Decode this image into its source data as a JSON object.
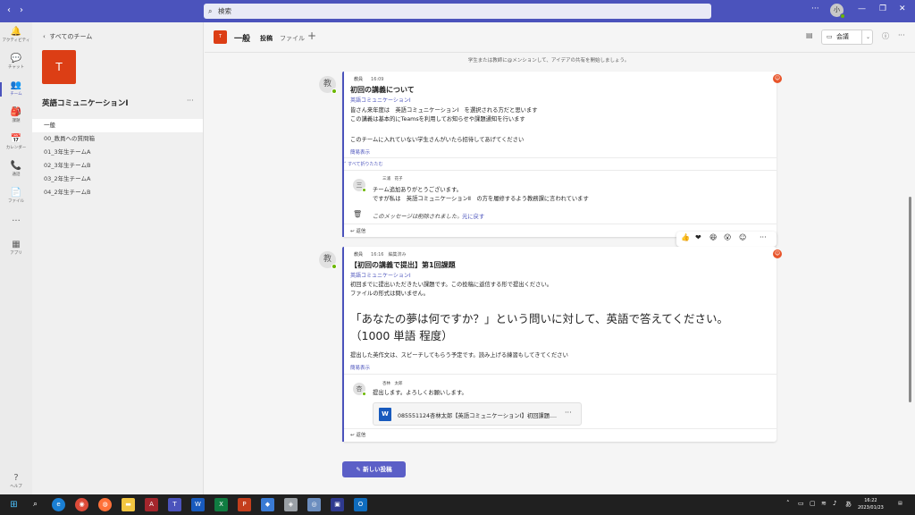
{
  "titlebar": {
    "search_placeholder": "検索",
    "avatar_initial": "小"
  },
  "rail": [
    {
      "label": "アクティビティ",
      "icon": "bell-icon",
      "glyph": "🔔"
    },
    {
      "label": "チャット",
      "icon": "chat-icon",
      "glyph": "💬"
    },
    {
      "label": "チーム",
      "icon": "teams-icon",
      "glyph": "👥"
    },
    {
      "label": "課題",
      "icon": "assignments-icon",
      "glyph": "🎒"
    },
    {
      "label": "カレンダー",
      "icon": "calendar-icon",
      "glyph": "📅"
    },
    {
      "label": "通話",
      "icon": "phone-icon",
      "glyph": "📞"
    },
    {
      "label": "ファイル",
      "icon": "file-icon",
      "glyph": "📄"
    },
    {
      "label": "アプリ",
      "icon": "apps-icon",
      "glyph": "▦"
    },
    {
      "label": "ヘルプ",
      "icon": "help-icon",
      "glyph": "?"
    }
  ],
  "sidebar": {
    "back_label": "すべてのチーム",
    "team_initial": "T",
    "team_name": "英語コミュニケーションⅠ",
    "channels": [
      "一般",
      "00_教員への質問箱",
      "01_3年生チームA",
      "02_3年生チームB",
      "03_2年生チームA",
      "04_2年生チームB"
    ]
  },
  "header": {
    "channel_initial": "T",
    "channel_name": "一般",
    "tabs": [
      "投稿",
      "ファイル"
    ],
    "meet_label": "会議"
  },
  "feed": {
    "notice": "学生または教師に@メンションして、アイデアの共有を開始しましょう。",
    "post1": {
      "avatar": "教",
      "author": "教員",
      "time": "16:09",
      "title": "初回の講義について",
      "tag": "英語コミュニケーションⅠ",
      "lines": [
        "皆さん来年度は　英語コミュニケーションⅠ　を選択される方だと思います",
        "この講義は基本的にTeamsを利用してお知らせや課題通知を行います",
        "このチームに入れていない学生さんがいたら招待してあげてください"
      ],
      "show_less": "簡易表示",
      "collapse_all": "すべて折りたたむ",
      "reply": {
        "avatar": "三",
        "author": "三浦　花子",
        "lines": [
          "チーム追加ありがとうございます。",
          "ですが私は　英語コミュニケーションⅡ　の方を履修するよう教務課に言われています"
        ]
      },
      "deleted_text": "このメッセージは削除されました。",
      "undo_label": "元に戻す",
      "reply_label": "返信"
    },
    "post2": {
      "avatar": "教",
      "author": "教員",
      "time": "16:16",
      "edited": "編集済み",
      "title": "【初回の講義で提出】第1回課題",
      "tag": "英語コミュニケーションⅠ",
      "lines": [
        "初回までに提出いただきたい課題です。この投稿に返信する形で提出ください。",
        "ファイルの形式は問いません。"
      ],
      "big_line1": "「あなたの夢は何ですか？」という問いに対して、英語で答えてください。",
      "big_line2": "（1000 単語 程度）",
      "footer_line": "提出した英作文は、スピーチしてもらう予定です。読み上げる練習もしてきてください",
      "show_less": "簡易表示",
      "reply": {
        "avatar": "杏",
        "author": "杏林　太郎",
        "text": "提出します。よろしくお願いします。",
        "file": "085551124杏林太郎【英語コミュニケーションⅠ】初回課題...."
      },
      "reply_label": "返信"
    },
    "new_post_label": "新しい投稿"
  },
  "taskbar": {
    "time": "16:22",
    "date": "2023/01/23",
    "ime": "あ"
  },
  "colors": {
    "accent": "#4b53bc",
    "team": "#dc3e15",
    "online": "#6bb700"
  }
}
